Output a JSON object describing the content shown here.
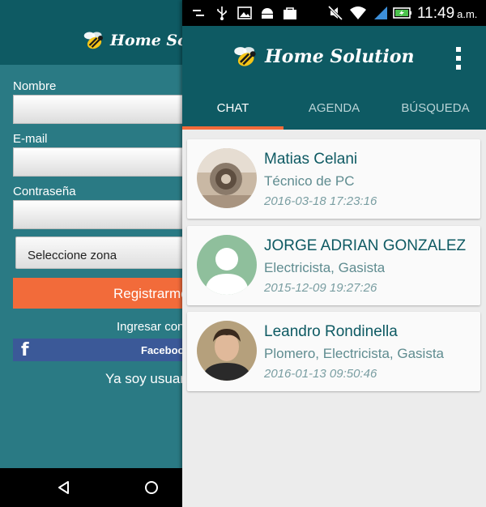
{
  "left": {
    "logo_text": "Home Solution",
    "name_label": "Nombre",
    "email_label": "E-mail",
    "password_label": "Contraseña",
    "zone_select": "Seleccione zona",
    "register_button": "Registrarme",
    "login_with": "Ingresar con",
    "facebook_button": "Facebook",
    "facebook_icon": "f",
    "already_user": "Ya soy usuario"
  },
  "status_bar": {
    "time": "11:49",
    "ampm": "a.m."
  },
  "header": {
    "logo_text": "Home Solution",
    "icons": [
      "bee-logo-icon",
      "overflow-menu-icon"
    ]
  },
  "tabs": [
    {
      "label": "CHAT",
      "active": true
    },
    {
      "label": "AGENDA",
      "active": false
    },
    {
      "label": "BÚSQUEDA",
      "active": false
    }
  ],
  "chats": [
    {
      "name": "Matias Celani",
      "job": "Técnico de PC",
      "date": "2016-03-18 17:23:16",
      "avatar": "photo"
    },
    {
      "name": "JORGE ADRIAN GONZALEZ",
      "job": "Electricista, Gasista",
      "date": "2015-12-09 19:27:26",
      "avatar": "placeholder"
    },
    {
      "name": "Leandro Rondinella",
      "job": "Plomero, Electricista, Gasista",
      "date": "2016-01-13 09:50:46",
      "avatar": "photo"
    }
  ],
  "colors": {
    "primary": "#0e5a63",
    "accent": "#f26b3a",
    "facebook": "#3b5998",
    "placeholder_avatar": "#8fbf9c"
  }
}
